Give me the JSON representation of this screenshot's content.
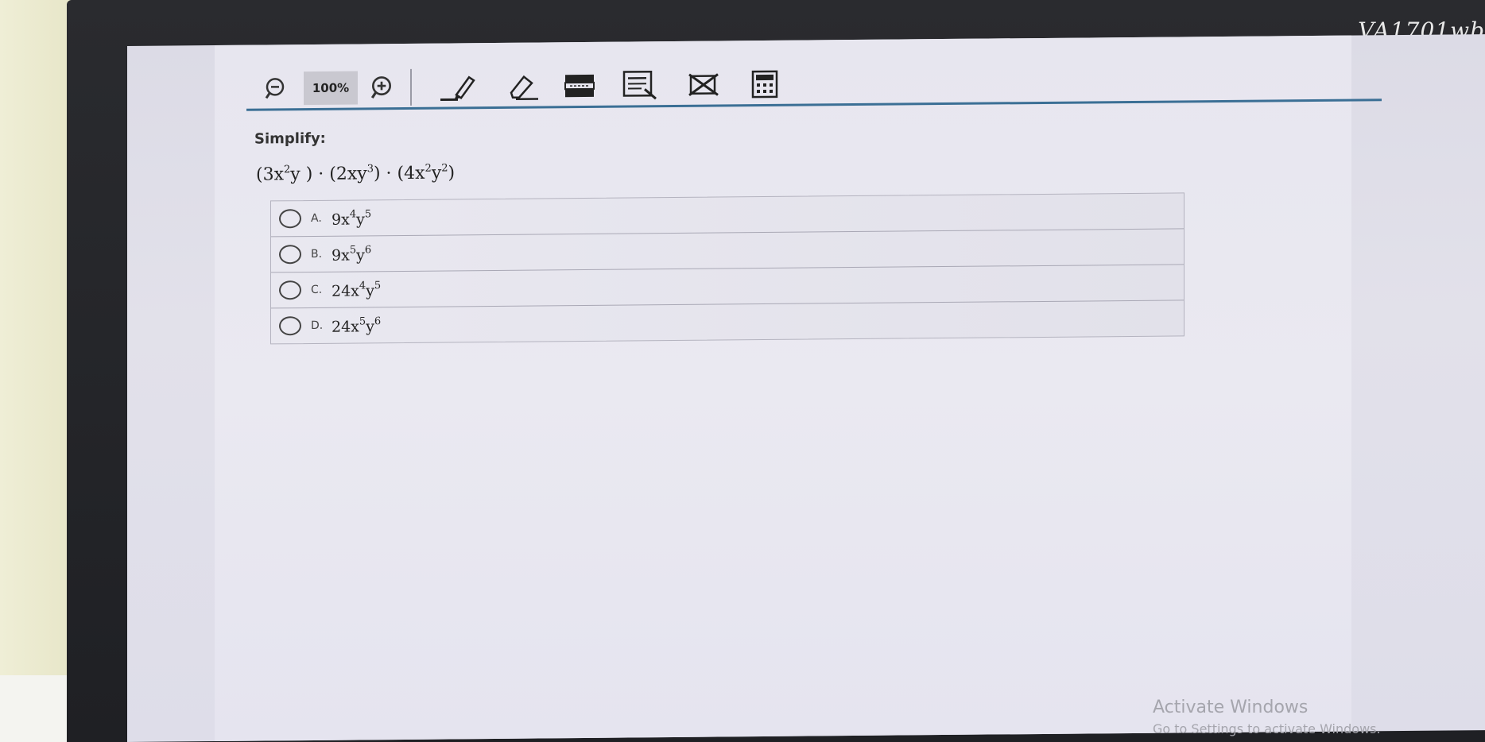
{
  "monitor": {
    "model_label": "VA1701wb"
  },
  "toolbar": {
    "zoom_level": "100%",
    "tools": [
      "zoom-out-icon",
      "zoom-in-icon",
      "highlighter-icon",
      "eraser-icon",
      "line-reader-icon",
      "answer-masking-icon",
      "answer-eliminator-icon",
      "calculator-icon"
    ]
  },
  "question": {
    "prompt": "Simplify:",
    "expression_parts": [
      {
        "base": "(3x",
        "exp": "2"
      },
      {
        "base": "y ) · (2xy",
        "exp": "3"
      },
      {
        "base": ") · (4x",
        "exp": "2"
      },
      {
        "base": "y",
        "exp": "2"
      },
      {
        "base": ")",
        "exp": ""
      }
    ]
  },
  "choices": [
    {
      "letter": "A.",
      "coef": "9x",
      "e1": "4",
      "var2": "y",
      "e2": "5"
    },
    {
      "letter": "B.",
      "coef": "9x",
      "e1": "5",
      "var2": "y",
      "e2": "6"
    },
    {
      "letter": "C.",
      "coef": "24x",
      "e1": "4",
      "var2": "y",
      "e2": "5"
    },
    {
      "letter": "D.",
      "coef": "24x",
      "e1": "5",
      "var2": "y",
      "e2": "6"
    }
  ],
  "watermark": {
    "title": "Activate Windows",
    "subtitle": "Go to Settings to activate Windows."
  }
}
